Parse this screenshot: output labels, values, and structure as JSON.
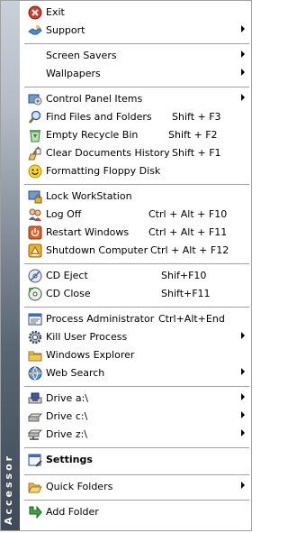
{
  "sidebar": {
    "label": "Accessor"
  },
  "menu": {
    "exit": "Exit",
    "support": "Support",
    "screen_savers": "Screen Savers",
    "wallpapers": "Wallpapers",
    "control_panel": "Control Panel Items",
    "find_files": {
      "label": "Find Files and Folders",
      "shortcut": "Shift + F3"
    },
    "empty_recycle": {
      "label": "Empty Recycle Bin",
      "shortcut": "Shift + F2"
    },
    "clear_docs": {
      "label": "Clear Documents History",
      "shortcut": "Shift + F1"
    },
    "format_floppy": "Formatting Floppy Disk",
    "lock": "Lock WorkStation",
    "log_off": {
      "label": "Log Off",
      "shortcut": "Ctrl + Alt + F10"
    },
    "restart": {
      "label": "Restart Windows",
      "shortcut": "Ctrl + Alt + F11"
    },
    "shutdown": {
      "label": "Shutdown Computer",
      "shortcut": "Ctrl + Alt + F12"
    },
    "cd_eject": {
      "label": "CD Eject",
      "shortcut": "Shif+F10"
    },
    "cd_close": {
      "label": "CD Close",
      "shortcut": "Shift+F11"
    },
    "process_admin": {
      "label": "Process Administrator",
      "shortcut": "Ctrl+Alt+End"
    },
    "kill_process": "Kill User Process",
    "win_explorer": "Windows Explorer",
    "web_search": "Web Search",
    "drive_a": "Drive a:\\",
    "drive_c": "Drive c:\\",
    "drive_z": "Drive z:\\",
    "settings": "Settings",
    "quick_folders": "Quick Folders",
    "add_folder": "Add Folder"
  }
}
